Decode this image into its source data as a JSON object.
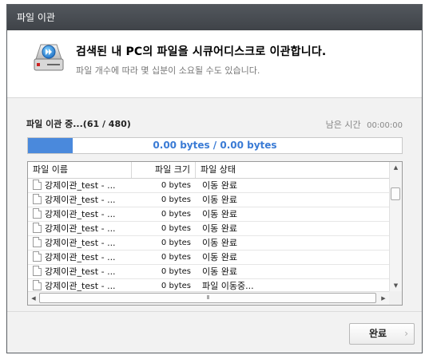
{
  "window": {
    "title": "파일 이관"
  },
  "header": {
    "headline": "검색된 내 PC의 파일을 시큐어디스크로 이관합니다.",
    "subline": "파일 개수에 따라 몇 십분이 소요될 수도 있습니다.",
    "icon": "drive-transfer-icon"
  },
  "status": {
    "label": "파일 이관 중...(61 / 480)",
    "time_label": "남은 시간",
    "time_value": "00:00:00"
  },
  "progress": {
    "text": "0.00 bytes / 0.00 bytes",
    "value": 0.12,
    "fill_color": "#4a89dc"
  },
  "table": {
    "columns": [
      "파일 이름",
      "파일 크기",
      "파일 상태"
    ],
    "rows": [
      {
        "name": "강제이관_test - ...",
        "size": "0 bytes",
        "status": "이동 완료"
      },
      {
        "name": "강제이관_test - ...",
        "size": "0 bytes",
        "status": "이동 완료"
      },
      {
        "name": "강제이관_test - ...",
        "size": "0 bytes",
        "status": "이동 완료"
      },
      {
        "name": "강제이관_test - ...",
        "size": "0 bytes",
        "status": "이동 완료"
      },
      {
        "name": "강제이관_test - ...",
        "size": "0 bytes",
        "status": "이동 완료"
      },
      {
        "name": "강제이관_test - ...",
        "size": "0 bytes",
        "status": "이동 완료"
      },
      {
        "name": "강제이관_test - ...",
        "size": "0 bytes",
        "status": "이동 완료"
      },
      {
        "name": "강제이관_test - ...",
        "size": "0 bytes",
        "status": "파일 이동중..."
      }
    ]
  },
  "scrollbar": {
    "h_grip": "III"
  },
  "footer": {
    "done_label": "완료"
  }
}
